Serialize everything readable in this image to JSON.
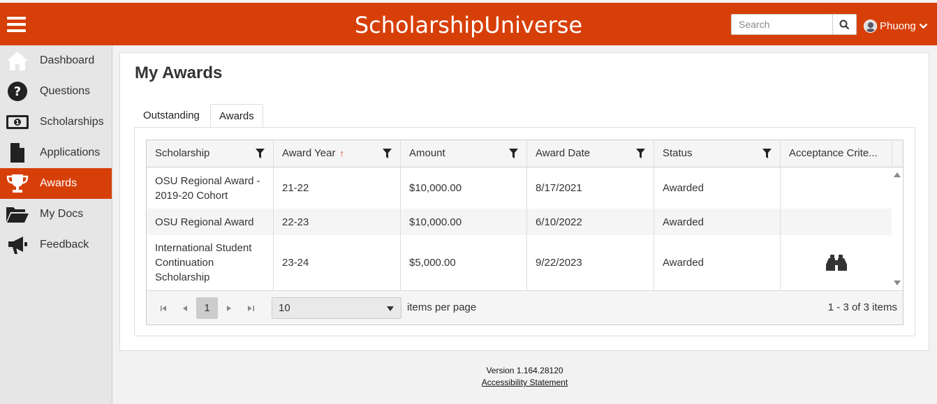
{
  "app": {
    "brand": "ScholarshipUniverse"
  },
  "header": {
    "search_placeholder": "Search",
    "user_name": "Phuong"
  },
  "sidebar": {
    "items": [
      {
        "label": "Dashboard",
        "icon": "home-icon"
      },
      {
        "label": "Questions",
        "icon": "question-icon"
      },
      {
        "label": "Scholarships",
        "icon": "money-icon"
      },
      {
        "label": "Applications",
        "icon": "document-icon"
      },
      {
        "label": "Awards",
        "icon": "trophy-icon",
        "active": true
      },
      {
        "label": "My Docs",
        "icon": "folder-icon"
      },
      {
        "label": "Feedback",
        "icon": "megaphone-icon"
      }
    ]
  },
  "main": {
    "title": "My Awards",
    "tabs": [
      {
        "label": "Outstanding"
      },
      {
        "label": "Awards",
        "active": true
      }
    ],
    "grid": {
      "columns": [
        "Scholarship",
        "Award Year",
        "Amount",
        "Award Date",
        "Status",
        "Acceptance Crite..."
      ],
      "sort_indicator": "↑",
      "rows": [
        {
          "scholarship": "OSU Regional Award - 2019-20 Cohort",
          "year": "21-22",
          "amount": "$10,000.00",
          "date": "8/17/2021",
          "status": "Awarded",
          "criteria_icon": ""
        },
        {
          "scholarship": "OSU Regional Award",
          "year": "22-23",
          "amount": "$10,000.00",
          "date": "6/10/2022",
          "status": "Awarded",
          "criteria_icon": ""
        },
        {
          "scholarship": "International Student Continuation Scholarship",
          "year": "23-24",
          "amount": "$5,000.00",
          "date": "9/22/2023",
          "status": "Awarded",
          "criteria_icon": "binoculars-icon"
        }
      ]
    },
    "pager": {
      "current_page": "1",
      "page_size": "10",
      "per_page_label": "items per page",
      "info": "1 - 3 of 3 items"
    }
  },
  "footer": {
    "version": "Version 1.164.28120",
    "accessibility_link": "Accessibility Statement"
  },
  "colors": {
    "brand": "#d73f09",
    "sidebar_bg": "#e6e6e6"
  }
}
